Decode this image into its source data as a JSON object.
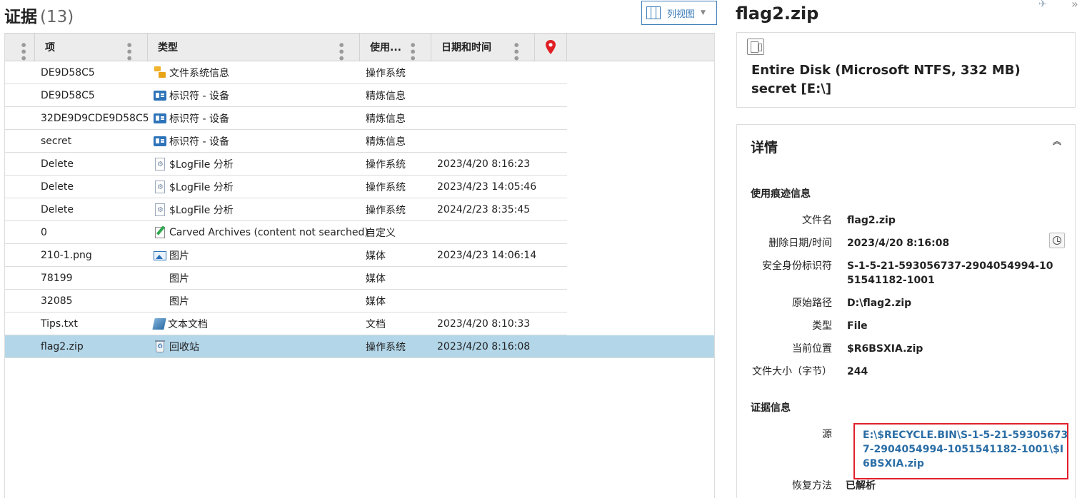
{
  "evidence": {
    "title": "证据",
    "count": "(13)",
    "view_button_label": "列视图"
  },
  "grid": {
    "columns": [
      "项",
      "类型",
      "使用...",
      "日期和时间"
    ],
    "rows": [
      {
        "item": "DE9D58C5",
        "icon": "folder-tree-icon",
        "type": "文件系统信息",
        "usage": "操作系统",
        "datetime": ""
      },
      {
        "item": "DE9D58C5",
        "icon": "id-card-icon",
        "type": "标识符 - 设备",
        "usage": "精炼信息",
        "datetime": ""
      },
      {
        "item": "32DE9D9CDE9D58C5",
        "icon": "id-card-icon",
        "type": "标识符 - 设备",
        "usage": "精炼信息",
        "datetime": ""
      },
      {
        "item": "secret",
        "icon": "id-card-icon",
        "type": "标识符 - 设备",
        "usage": "精炼信息",
        "datetime": ""
      },
      {
        "item": "Delete",
        "icon": "log-file-icon",
        "type": "$LogFile 分析",
        "usage": "操作系统",
        "datetime": "2023/4/20 8:16:23"
      },
      {
        "item": "Delete",
        "icon": "log-file-icon",
        "type": "$LogFile 分析",
        "usage": "操作系统",
        "datetime": "2023/4/23 14:05:46"
      },
      {
        "item": "Delete",
        "icon": "log-file-icon",
        "type": "$LogFile 分析",
        "usage": "操作系统",
        "datetime": "2024/2/23 8:35:45"
      },
      {
        "item": "0",
        "icon": "carved-archive-icon",
        "type": "Carved Archives (content not searched)",
        "usage": "自定义",
        "datetime": ""
      },
      {
        "item": "210-1.png",
        "icon": "picture-icon",
        "type": "图片",
        "usage": "媒体",
        "datetime": "2023/4/23 14:06:14"
      },
      {
        "item": "78199",
        "icon": "none",
        "type": "图片",
        "usage": "媒体",
        "datetime": ""
      },
      {
        "item": "32085",
        "icon": "none",
        "type": "图片",
        "usage": "媒体",
        "datetime": ""
      },
      {
        "item": "Tips.txt",
        "icon": "text-document-icon",
        "type": "文本文档",
        "usage": "文档",
        "datetime": "2023/4/20 8:10:33"
      },
      {
        "item": "flag2.zip",
        "icon": "recycle-bin-icon",
        "type": "回收站",
        "usage": "操作系统",
        "datetime": "2023/4/20 8:16:08",
        "selected": true
      }
    ]
  },
  "detail": {
    "title": "flag2.zip",
    "source_text": "Entire Disk (Microsoft NTFS, 332 MB) secret [E:\\]",
    "details_heading": "详情",
    "usage_section": "使用痕迹信息",
    "fields": [
      {
        "label": "文件名",
        "value": "flag2.zip"
      },
      {
        "label": "删除日期/时间",
        "value": "2023/4/20 8:16:08"
      },
      {
        "label": "安全身份标识符",
        "value": "S-1-5-21-593056737-2904054994-1051541182-1001"
      },
      {
        "label": "原始路径",
        "value": "D:\\flag2.zip"
      },
      {
        "label": "类型",
        "value": "File"
      },
      {
        "label": "当前位置",
        "value": "$R6BSXIA.zip"
      },
      {
        "label": "文件大小（字节）",
        "value": "244"
      }
    ],
    "evidence_section": "证据信息",
    "source_label": "源",
    "source_link": "E:\\$RECYCLE.BIN\\S-1-5-21-593056737-2904054994-1051541182-1001\\$I6BSXIA.zip",
    "recovery_label": "恢复方法",
    "recovery_value": "已解析"
  },
  "colors": {
    "accent": "#3a7bb8",
    "selected_row": "#b3d6e9",
    "highlight_box": "#e0202a",
    "link": "#2b6ea6",
    "pin_red": "#e01e24"
  }
}
